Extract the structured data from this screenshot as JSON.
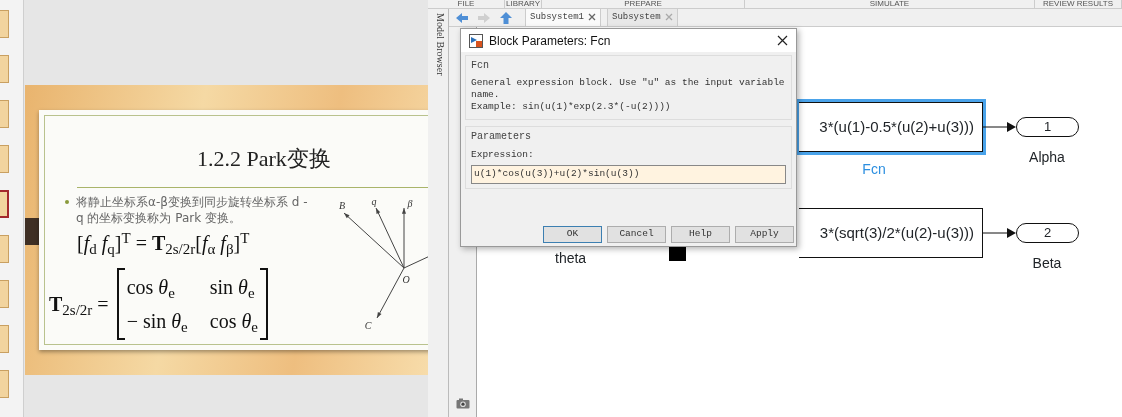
{
  "slide_thumbnails": [
    {
      "selected": false
    },
    {
      "selected": false
    },
    {
      "selected": false
    },
    {
      "selected": false
    },
    {
      "selected": true
    },
    {
      "selected": false
    },
    {
      "selected": false
    },
    {
      "selected": false
    },
    {
      "selected": false
    }
  ],
  "slide": {
    "title": "1.2.2  Park变换",
    "bullet": "将静止坐标系α-β变换到同步旋转坐标系 d -q 的坐标变换称为 Park 变换。",
    "formula": "[*f*$_{d}$   *f*$_{q}$]$^{T}$ = **T**$_{2s/2r}$[*f*$_{α}$   *f*$_{β}$]$^{T}$",
    "matrix": {
      "lhs": "**T**$_{2s/2r}$ =",
      "cells": [
        "cos *θ*$_{e}$",
        "sin *θ*$_{e}$",
        "− sin *θ*$_{e}$",
        "cos *θ*$_{e}$"
      ]
    },
    "diagram_labels": [
      "B",
      "q",
      "β",
      "O",
      "C"
    ]
  },
  "simulink": {
    "ribbon_tabs": [
      "FILE",
      "LIBRARY",
      "PREPARE",
      "SIMULATE",
      "REVIEW RESULTS"
    ],
    "side_label": "Model Browser",
    "nav_buttons": [
      {
        "kind": "back",
        "disabled": false
      },
      {
        "kind": "forward",
        "disabled": true
      },
      {
        "kind": "up",
        "disabled": false
      }
    ],
    "doc_tabs": [
      {
        "label": "Subsystem1",
        "selected": true
      },
      {
        "label": "Subsystem",
        "selected": false
      }
    ],
    "blocks": [
      {
        "text": "3*(u(1)-0.5*(u(2)+u(3)))",
        "label": "Fcn",
        "selected": true
      },
      {
        "text": "3*(sqrt(3)/2*(u(2)-u(3)))",
        "selected": false
      }
    ],
    "outports": [
      {
        "number": "1",
        "label": "Alpha"
      },
      {
        "number": "2",
        "label": "Beta"
      }
    ],
    "inport_label": "theta"
  },
  "dialog": {
    "title": "Block Parameters: Fcn",
    "group": "Fcn",
    "description": "General expression block. Use \"u\" as the input variable name.",
    "example": "Example: sin(u(1)*exp(2.3*(-u(2))))",
    "params_group": "Parameters",
    "expression_label": "Expression:",
    "expression": "u(1)*cos(u(3))+u(2)*sin(u(3))",
    "buttons": [
      {
        "label": "OK",
        "default": true
      },
      {
        "label": "Cancel",
        "default": false
      },
      {
        "label": "Help",
        "default": false
      },
      {
        "label": "Apply",
        "default": false
      }
    ]
  }
}
